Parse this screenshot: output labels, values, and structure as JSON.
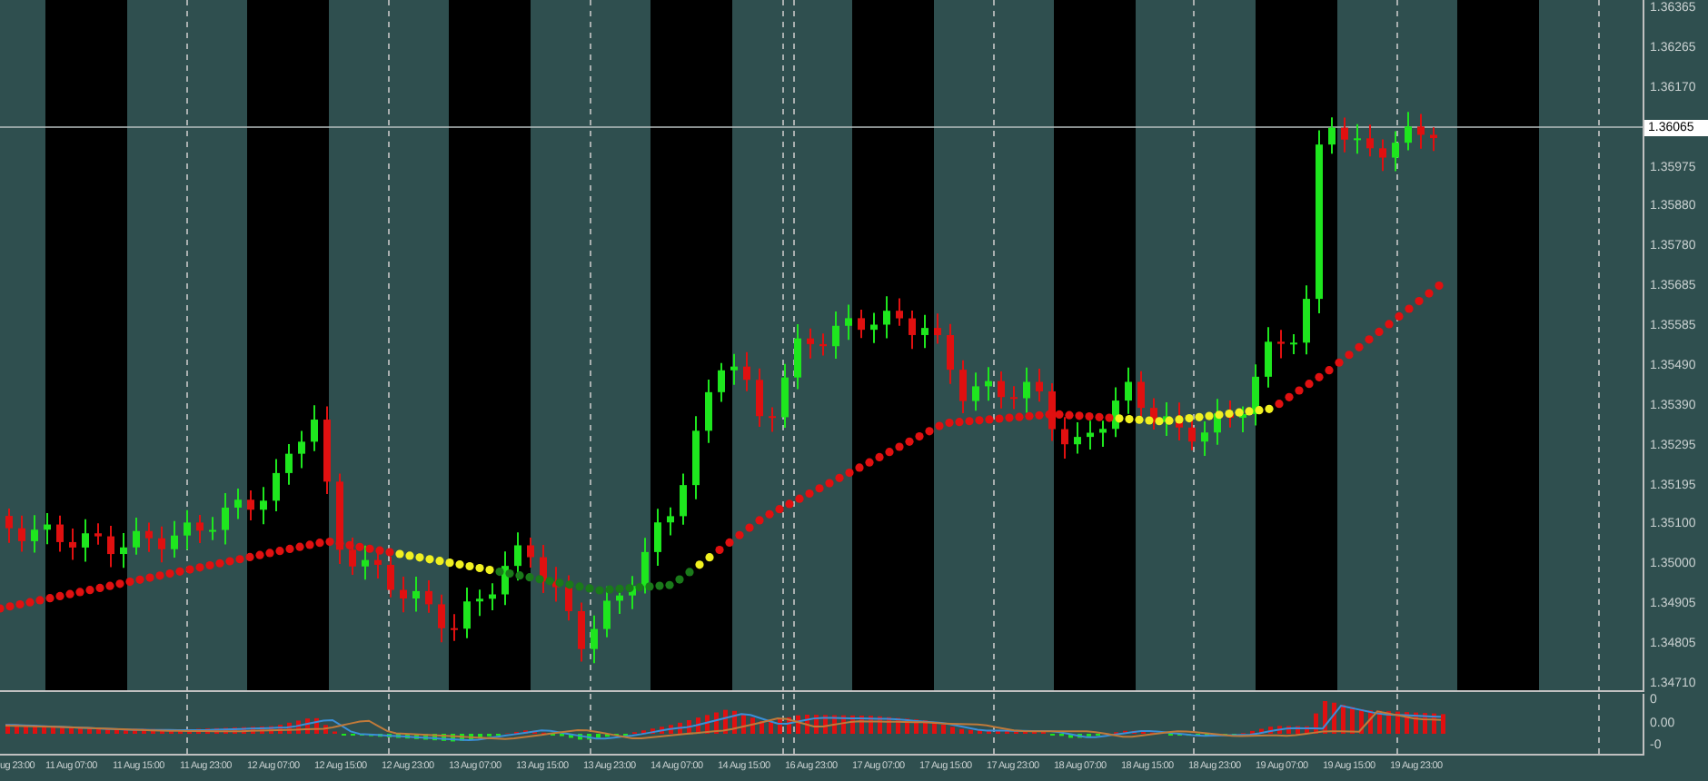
{
  "price_axis": [
    {
      "text": "1.36365",
      "current": false
    },
    {
      "text": "1.36265",
      "current": false
    },
    {
      "text": "1.36170",
      "current": false
    },
    {
      "text": "1.36065",
      "current": true
    },
    {
      "text": "1.35975",
      "current": false
    },
    {
      "text": "1.35880",
      "current": false
    },
    {
      "text": "1.35780",
      "current": false
    },
    {
      "text": "1.35685",
      "current": false
    },
    {
      "text": "1.35585",
      "current": false
    },
    {
      "text": "1.35490",
      "current": false
    },
    {
      "text": "1.35390",
      "current": false
    },
    {
      "text": "1.35295",
      "current": false
    },
    {
      "text": "1.35195",
      "current": false
    },
    {
      "text": "1.35100",
      "current": false
    },
    {
      "text": "1.35000",
      "current": false
    },
    {
      "text": "1.34905",
      "current": false
    },
    {
      "text": "1.34805",
      "current": false
    },
    {
      "text": "1.34710",
      "current": false
    }
  ],
  "indicator_axis": [
    "0",
    "0.00",
    "-0"
  ],
  "time_axis": [
    "ug 23:00",
    "11 Aug 07:00",
    "11 Aug 15:00",
    "11 Aug 23:00",
    "12 Aug 07:00",
    "12 Aug 15:00",
    "12 Aug 23:00",
    "13 Aug 07:00",
    "13 Aug 15:00",
    "13 Aug 23:00",
    "14 Aug 07:00",
    "14 Aug 15:00",
    "16 Aug 23:00",
    "17 Aug 07:00",
    "17 Aug 15:00",
    "17 Aug 23:00",
    "18 Aug 07:00",
    "18 Aug 15:00",
    "18 Aug 23:00",
    "19 Aug 07:00",
    "19 Aug 15:00",
    "19 Aug 23:00"
  ]
}
